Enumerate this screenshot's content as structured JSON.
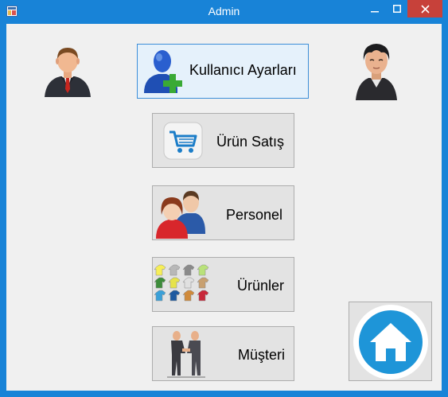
{
  "window": {
    "title": "Admin",
    "controls": {
      "minimize": "minimize-icon",
      "maximize": "maximize-icon",
      "close": "close-icon"
    },
    "colors": {
      "titlebar": "#1883d7",
      "close": "#c7413a",
      "client": "#f0f0f0"
    }
  },
  "buttons": {
    "user_settings": "Kullanıcı Ayarları",
    "product_sales": "Ürün Satış",
    "staff": "Personel",
    "products": "Ürünler",
    "customer": "Müşteri"
  },
  "icons": {
    "user_settings": "add-user-icon",
    "product_sales": "shopping-cart-icon",
    "staff": "people-icon",
    "products": "clothes-icon",
    "customer": "handshake-icon",
    "home": "home-icon",
    "left_avatar": "businessman-avatar",
    "right_avatar": "man-avatar"
  }
}
